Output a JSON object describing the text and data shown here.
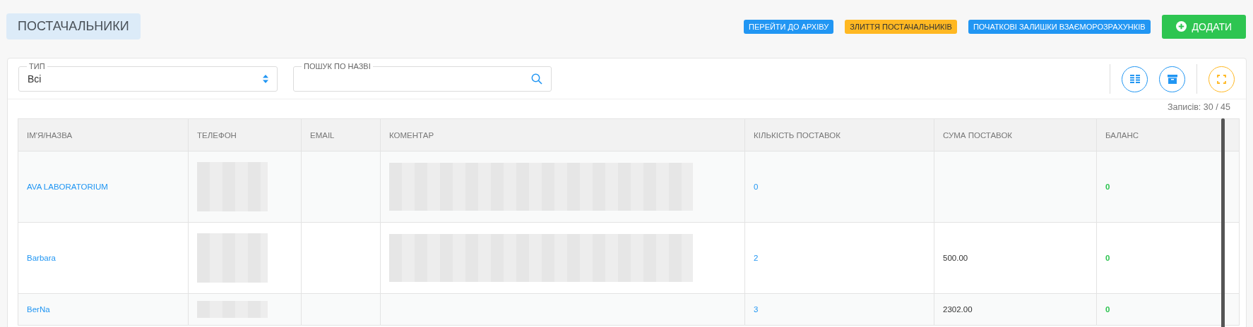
{
  "title": "ПОСТАЧАЛЬНИКИ",
  "header_buttons": [
    {
      "label": "ПЕРЕЙТИ ДО АРХІВУ",
      "kind": "info"
    },
    {
      "label": "ЗЛИТТЯ ПОСТАЧАЛЬНИКІВ",
      "kind": "warning"
    },
    {
      "label": "ПОЧАТКОВІ ЗАЛИШКИ ВЗАЄМОРОЗРАХУНКІВ",
      "kind": "info"
    }
  ],
  "add_button": {
    "label": "ДОДАТИ"
  },
  "filters": {
    "type": {
      "label": "ТИП",
      "value": "Всі"
    },
    "search": {
      "label": "ПОШУК ПО НАЗВІ"
    }
  },
  "records": "Записів: 30 / 45",
  "table": {
    "columns": [
      "ІМ'Я/НАЗВА",
      "ТЕЛЕФОН",
      "EMAIL",
      "КОМЕНТАР",
      "КІЛЬКІСТЬ ПОСТАВОК",
      "СУМА ПОСТАВОК",
      "БАЛАНС"
    ],
    "rows": [
      {
        "name": "AVA LABORATORIUM",
        "phone_redacted": true,
        "comment_redacted": true,
        "deliveries": "0",
        "sum": "",
        "balance": "0"
      },
      {
        "name": "Barbara",
        "phone_redacted": true,
        "comment_redacted": true,
        "deliveries": "2",
        "sum": "500.00",
        "balance": "0"
      },
      {
        "name": "BerNa",
        "phone_redacted": true,
        "comment_redacted": false,
        "deliveries": "3",
        "sum": "2302.00",
        "balance": "0"
      }
    ]
  }
}
